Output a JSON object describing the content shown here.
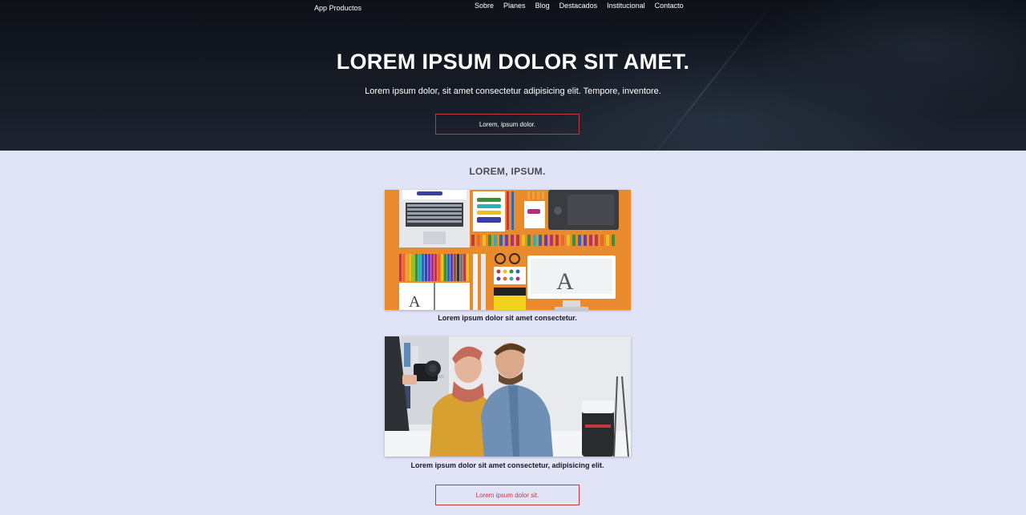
{
  "header": {
    "brand": "App Productos",
    "nav": [
      "Sobre",
      "Planes",
      "Blog",
      "Destacados",
      "Institucional",
      "Contacto"
    ]
  },
  "hero": {
    "title": "LOREM IPSUM DOLOR SIT AMET.",
    "subtitle": "Lorem ipsum dolor, sit amet consectetur adipisicing elit. Tempore, inventore.",
    "button": "Lorem, ipsum dolor."
  },
  "section": {
    "title": "LOREM, IPSUM.",
    "cards": [
      {
        "caption": "Lorem ipsum dolor sit amet consectetur."
      },
      {
        "caption": "Lorem ipsum dolor sit amet consectetur, adipisicing elit."
      }
    ],
    "button": "Lorem ipsum dolor sit."
  },
  "colors": {
    "background": "#e1e3f7",
    "accent": "#c0393f",
    "hero": "#141822"
  }
}
